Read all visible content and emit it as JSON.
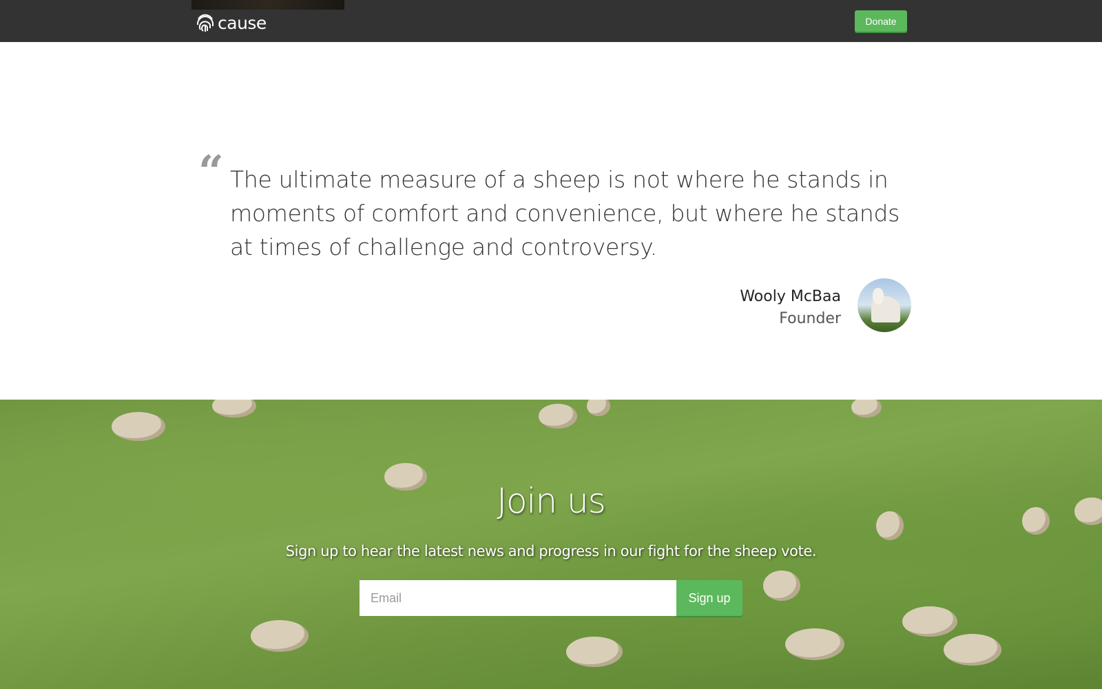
{
  "navbar": {
    "brand": "cause",
    "donate_label": "Donate"
  },
  "testimonial": {
    "quote_mark": "“",
    "quote": "The ultimate measure of a sheep is not where he stands in moments of comfort and convenience, but where he stands at times of challenge and controversy.",
    "author_name": "Wooly McBaa",
    "author_role": "Founder"
  },
  "signup": {
    "title": "Join us",
    "subtitle": "Sign up to hear the latest news and progress in our fight for the sheep vote.",
    "email_placeholder": "Email",
    "email_value": "",
    "button_label": "Sign up"
  },
  "colors": {
    "navbar": "#333333",
    "accent": "#5cb85c"
  }
}
